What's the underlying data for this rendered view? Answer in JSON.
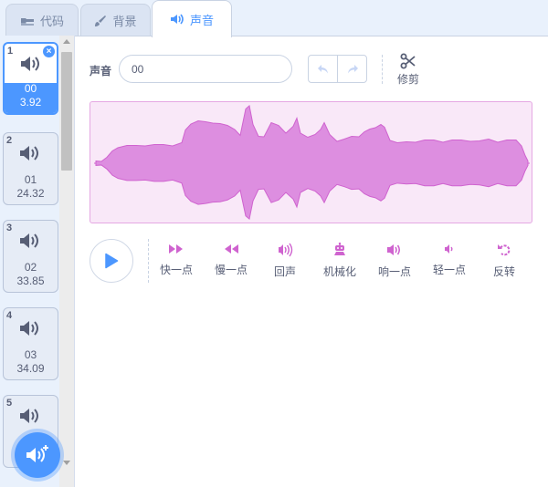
{
  "tabs": [
    {
      "label": "代码",
      "icon": "code-icon"
    },
    {
      "label": "背景",
      "icon": "brush-icon"
    },
    {
      "label": "声音",
      "icon": "sound-icon"
    }
  ],
  "sounds": [
    {
      "index": "1",
      "name": "00",
      "duration": "3.92",
      "selected": true
    },
    {
      "index": "2",
      "name": "01",
      "duration": "24.32"
    },
    {
      "index": "3",
      "name": "02",
      "duration": "33.85"
    },
    {
      "index": "4",
      "name": "03",
      "duration": "34.09"
    },
    {
      "index": "5",
      "name": "",
      "duration": ""
    }
  ],
  "editor": {
    "name_label": "声音",
    "name_value": "00",
    "trim_label": "修剪"
  },
  "effects": [
    {
      "label": "快一点",
      "icon": "faster-icon"
    },
    {
      "label": "慢一点",
      "icon": "slower-icon"
    },
    {
      "label": "回声",
      "icon": "echo-icon"
    },
    {
      "label": "机械化",
      "icon": "robot-icon"
    },
    {
      "label": "响一点",
      "icon": "louder-icon"
    },
    {
      "label": "轻一点",
      "icon": "softer-icon"
    },
    {
      "label": "反转",
      "icon": "reverse-icon"
    }
  ],
  "colors": {
    "accent": "#4c97ff",
    "sound_wave": "#cf63cf",
    "wave_fill": "#dd8ee0",
    "wave_background": "#f9e8f8",
    "effect_icon": "#cf63cf"
  }
}
